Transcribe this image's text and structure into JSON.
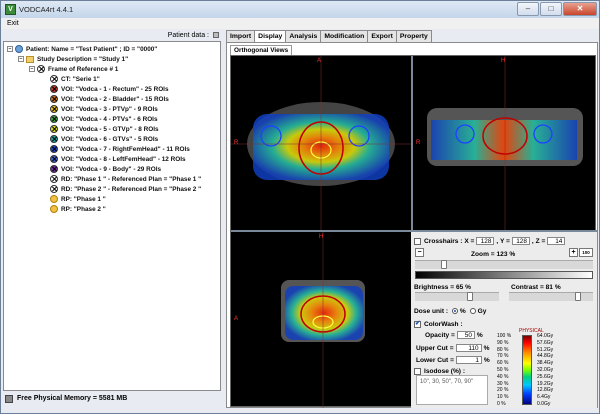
{
  "window": {
    "title": "VODCA4rt 4.4.1",
    "min": "–",
    "max": "□",
    "close": "✕"
  },
  "menu": {
    "exit": "Exit"
  },
  "left_panel": {
    "header": "Patient data :",
    "tree": [
      "Patient: Name = \"Test Patient\" ; ID = \"0000\"",
      "Study Description = \"Study 1\"",
      "Frame of Reference # 1",
      "CT: \"Serie 1\"",
      "VOI: \"Vodca - 1 - Rectum\" - 25 ROIs",
      "VOI: \"Vodca - 2 - Bladder\" - 15 ROIs",
      "VOI: \"Vodca - 3 - PTVp\" - 9 ROIs",
      "VOI: \"Vodca - 4 - PTVs\" - 6 ROIs",
      "VOI: \"Vodca - 5 - GTVp\" - 8 ROIs",
      "VOI: \"Vodca - 6 - GTVs\" - 5 ROIs",
      "VOI: \"Vodca - 7 - RightFemHead\" - 11 ROIs",
      "VOI: \"Vodca - 8 - LeftFemHead\" - 12 ROIs",
      "VOI: \"Vodca - 9 - Body\" - 29 ROIs",
      "RD: \"Phase 1 \" - Referenced Plan = \"Phase 1 \"",
      "RD: \"Phase 2 \" - Referenced Plan = \"Phase 2 \"",
      "RP: \"Phase 1 \"",
      "RP: \"Phase 2 \""
    ],
    "voi_colors": [
      "#c0392b",
      "#c87020",
      "#e8c020",
      "#40a040",
      "#e0e020",
      "#20a0a0",
      "#2040c0",
      "#4060d0",
      "#7030a0"
    ],
    "memory": "Free Physical Memory = 5581 MB"
  },
  "tabs": [
    "Import",
    "Display",
    "Analysis",
    "Modification",
    "Export",
    "Property"
  ],
  "active_tab": "Display",
  "subtab": "Orthogonal Views",
  "views": {
    "a": "A",
    "r": "R",
    "h": "H"
  },
  "controls": {
    "crosshairs": "Crosshairs",
    "x_label": ": X =",
    "x_val": "128",
    "y_label": ", Y =",
    "y_val": "128",
    "z_label": ", Z =",
    "z_val": "14",
    "zoom_label": "Zoom =",
    "zoom_val": "123",
    "zoom_unit": "%",
    "brightness_label": "Brightness =",
    "brightness_val": "65",
    "brightness_unit": "%",
    "contrast_label": "Contrast =",
    "contrast_val": "81",
    "contrast_unit": "%",
    "dose_unit_label": "Dose unit :",
    "dose_pct": "%",
    "dose_gy": "Gy",
    "colorwash": "ColorWash :",
    "opacity_label": "Opacity =",
    "opacity_val": "50",
    "opacity_unit": "%",
    "upper_label": "Upper Cut =",
    "upper_val": "110",
    "upper_unit": "%",
    "lower_label": "Lower Cut =",
    "lower_val": "1",
    "lower_unit": "%",
    "isodose_label": "Isodose (%) :",
    "isodose_values": "10\", 30, 50\", 70, 90\"",
    "btn_100": "100"
  },
  "legend": {
    "title": "PHYSICAL",
    "pct": [
      "100 %",
      "90 %",
      "80 %",
      "70 %",
      "60 %",
      "50 %",
      "40 %",
      "30 %",
      "20 %",
      "10 %",
      "0 %"
    ],
    "gy": [
      "64.0Gy",
      "57.6Gy",
      "51.2Gy",
      "44.8Gy",
      "38.4Gy",
      "32.0Gy",
      "25.6Gy",
      "19.2Gy",
      "12.8Gy",
      "6.4Gy",
      "0.0Gy"
    ]
  }
}
